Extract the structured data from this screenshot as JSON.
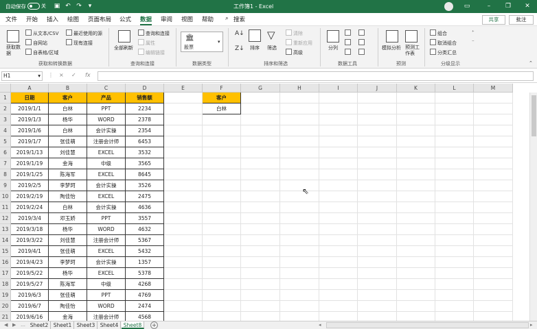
{
  "titlebar": {
    "autosave_label": "自动保存",
    "autosave_state": "关",
    "title": "工作簿1 - Excel",
    "icons": [
      "save-icon",
      "undo-icon",
      "redo-icon",
      "customize-icon"
    ]
  },
  "menu": {
    "tabs": [
      "文件",
      "开始",
      "插入",
      "绘图",
      "页面布局",
      "公式",
      "数据",
      "审阅",
      "视图",
      "帮助"
    ],
    "active_tab": "数据",
    "search": "搜索",
    "share": "共享",
    "comment": "批注"
  },
  "ribbon": {
    "get_data": "获取数据",
    "from_text": "从文本/CSV",
    "from_web": "自网站",
    "from_table": "自表格/区域",
    "recent_sources": "最近使用的源",
    "existing_connections": "现有连接",
    "group_get": "获取和转换数据",
    "refresh_all": "全部刷新",
    "queries_connections": "查询和连接",
    "properties": "属性",
    "edit_links": "编辑链接",
    "group_queries": "查询和连接",
    "stocks": "股票",
    "group_datatypes": "数据类型",
    "sort": "排序",
    "filter": "筛选",
    "clear": "清除",
    "reapply": "重新应用",
    "advanced": "高级",
    "group_sort": "排序和筛选",
    "text_to_columns": "分列",
    "group_tools": "数据工具",
    "what_if": "模拟分析",
    "forecast_sheet": "预测工作表",
    "group_forecast": "预测",
    "group": "组合",
    "ungroup": "取消组合",
    "subtotal": "分类汇总",
    "group_outline": "分级显示"
  },
  "formula_bar": {
    "name_box": "H1",
    "cancel": "×",
    "enter": "✓",
    "fx": "fx",
    "value": ""
  },
  "grid": {
    "columns": [
      "A",
      "B",
      "C",
      "D",
      "E",
      "F",
      "G",
      "H",
      "I",
      "J",
      "K",
      "L",
      "M"
    ],
    "rows": [
      "1",
      "2",
      "3",
      "4",
      "5",
      "6",
      "7",
      "8",
      "9",
      "10",
      "11",
      "12",
      "13",
      "14",
      "15",
      "16",
      "17",
      "18",
      "19",
      "20",
      "21"
    ],
    "headers": [
      "日期",
      "客户",
      "产品",
      "销售额"
    ],
    "data": [
      [
        "2019/1/1",
        "白林",
        "PPT",
        "2234"
      ],
      [
        "2019/1/3",
        "杨华",
        "WORD",
        "2378"
      ],
      [
        "2019/1/6",
        "白林",
        "会计实操",
        "2354"
      ],
      [
        "2019/1/7",
        "张佳萌",
        "注册会计师",
        "6453"
      ],
      [
        "2019/1/13",
        "刘佳慧",
        "EXCEL",
        "3532"
      ],
      [
        "2019/1/19",
        "金海",
        "中级",
        "3565"
      ],
      [
        "2019/1/25",
        "陈海军",
        "EXCEL",
        "8645"
      ],
      [
        "2019/2/5",
        "李梦珂",
        "会计实操",
        "3526"
      ],
      [
        "2019/2/19",
        "陶佳怡",
        "EXCEL",
        "2475"
      ],
      [
        "2019/2/24",
        "白林",
        "会计实操",
        "4636"
      ],
      [
        "2019/3/4",
        "邓玉娇",
        "PPT",
        "3557"
      ],
      [
        "2019/3/18",
        "杨华",
        "WORD",
        "4632"
      ],
      [
        "2019/3/22",
        "刘佳慧",
        "注册会计师",
        "5367"
      ],
      [
        "2019/4/1",
        "张佳萌",
        "EXCEL",
        "5432"
      ],
      [
        "2019/4/23",
        "李梦珂",
        "会计实操",
        "1357"
      ],
      [
        "2019/5/22",
        "杨华",
        "EXCEL",
        "5378"
      ],
      [
        "2019/5/27",
        "陈海军",
        "中级",
        "4268"
      ],
      [
        "2019/6/3",
        "张佳萌",
        "PPT",
        "4769"
      ],
      [
        "2019/6/7",
        "陶佳怡",
        "WORD",
        "2474"
      ],
      [
        "2019/6/16",
        "金海",
        "注册会计师",
        "4568"
      ]
    ],
    "criteria_header": "客户",
    "criteria_value": "白林"
  },
  "sheets": {
    "tabs": [
      "Sheet2",
      "Sheet1",
      "Sheet3",
      "Sheet4",
      "Sheet8"
    ],
    "active": "Sheet8",
    "add": "+"
  },
  "colors": {
    "brand": "#217346",
    "header_fill": "#ffc000"
  }
}
